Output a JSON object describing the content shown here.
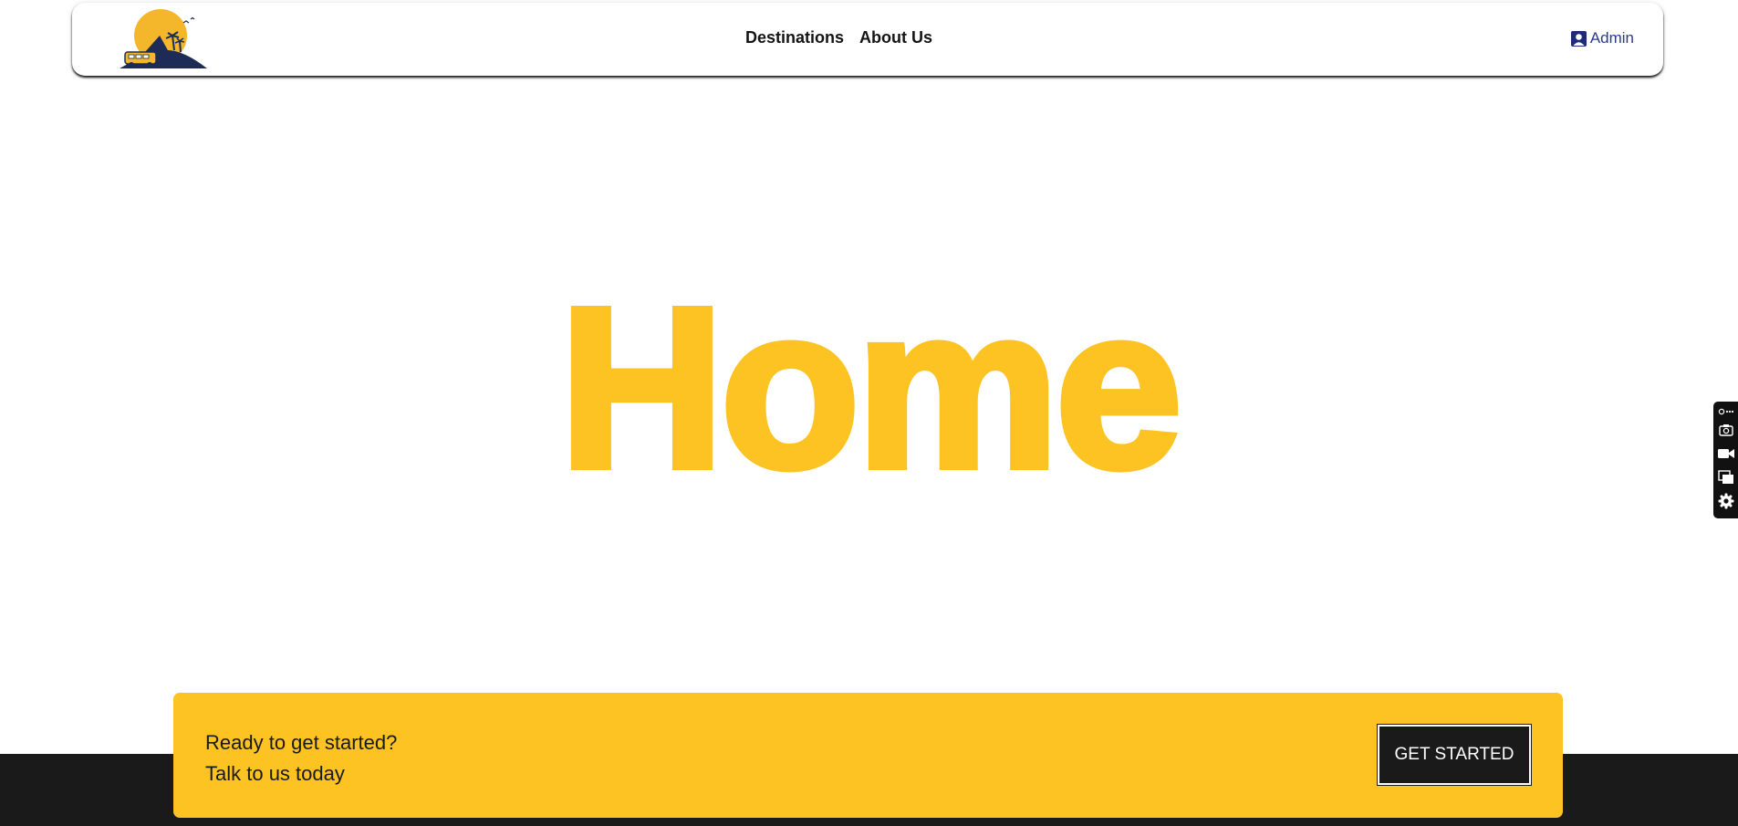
{
  "header": {
    "nav": [
      {
        "label": "Destinations"
      },
      {
        "label": "About Us"
      }
    ],
    "admin_label": "Admin",
    "logo_icon": "sun-island-bus-logo",
    "admin_icon": "user-badge-icon"
  },
  "hero": {
    "title": "Home"
  },
  "cta": {
    "line1": "Ready to get started?",
    "line2": "Talk to us today",
    "button_label": "GET STARTED"
  },
  "side_toolbar": {
    "icons": [
      "extension-menu-icon",
      "camera-icon",
      "video-camera-icon",
      "copy-window-icon",
      "gear-icon"
    ]
  },
  "colors": {
    "accent": "#fdc323",
    "dark": "#1a1a1a",
    "link_blue": "#2c3a8c"
  }
}
